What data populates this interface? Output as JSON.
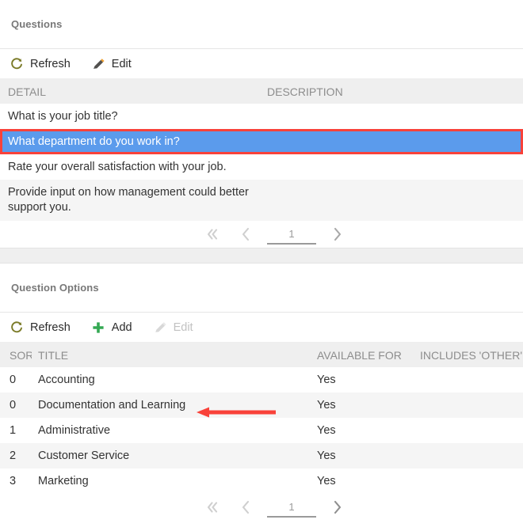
{
  "colors": {
    "selection_blue": "#5b9bec",
    "annotation_red": "#f9423a",
    "add_green": "#34a853",
    "refresh_olive": "#7a7a27",
    "header_gray": "#efefef"
  },
  "questions_panel": {
    "title": "Questions",
    "toolbar": [
      {
        "label": "Refresh",
        "icon": "refresh-icon",
        "enabled": true
      },
      {
        "label": "Edit",
        "icon": "pencil-icon",
        "enabled": true
      }
    ],
    "columns": [
      {
        "label": "DETAIL"
      },
      {
        "label": "DESCRIPTION"
      }
    ],
    "rows": [
      {
        "detail": "What is your job title?",
        "description": "",
        "selected": false
      },
      {
        "detail": "What department do you work in?",
        "description": "",
        "selected": true
      },
      {
        "detail": "Rate your overall satisfaction with your job.",
        "description": "",
        "selected": false
      },
      {
        "detail": "Provide input on how management could better support you.",
        "description": "",
        "selected": false
      }
    ],
    "pager": {
      "first_label": "«",
      "prev_label": "‹",
      "next_label": "›",
      "page_value": "1"
    }
  },
  "options_panel": {
    "title": "Question Options",
    "toolbar": [
      {
        "label": "Refresh",
        "icon": "refresh-icon",
        "enabled": true
      },
      {
        "label": "Add",
        "icon": "plus-icon",
        "enabled": true
      },
      {
        "label": "Edit",
        "icon": "pencil-icon",
        "enabled": false
      }
    ],
    "columns": [
      {
        "label": "SORT"
      },
      {
        "label": "TITLE"
      },
      {
        "label": "AVAILABLE FOR"
      },
      {
        "label": "INCLUDES 'OTHER'"
      }
    ],
    "rows": [
      {
        "sort": "0",
        "title": "Accounting",
        "available_for": "Yes",
        "includes_other": ""
      },
      {
        "sort": "0",
        "title": "Documentation and Learning",
        "available_for": "Yes",
        "includes_other": ""
      },
      {
        "sort": "1",
        "title": "Administrative",
        "available_for": "Yes",
        "includes_other": ""
      },
      {
        "sort": "2",
        "title": "Customer Service",
        "available_for": "Yes",
        "includes_other": ""
      },
      {
        "sort": "3",
        "title": "Marketing",
        "available_for": "Yes",
        "includes_other": ""
      }
    ],
    "pager": {
      "first_label": "«",
      "prev_label": "‹",
      "next_label": "›",
      "page_value": "1"
    }
  }
}
